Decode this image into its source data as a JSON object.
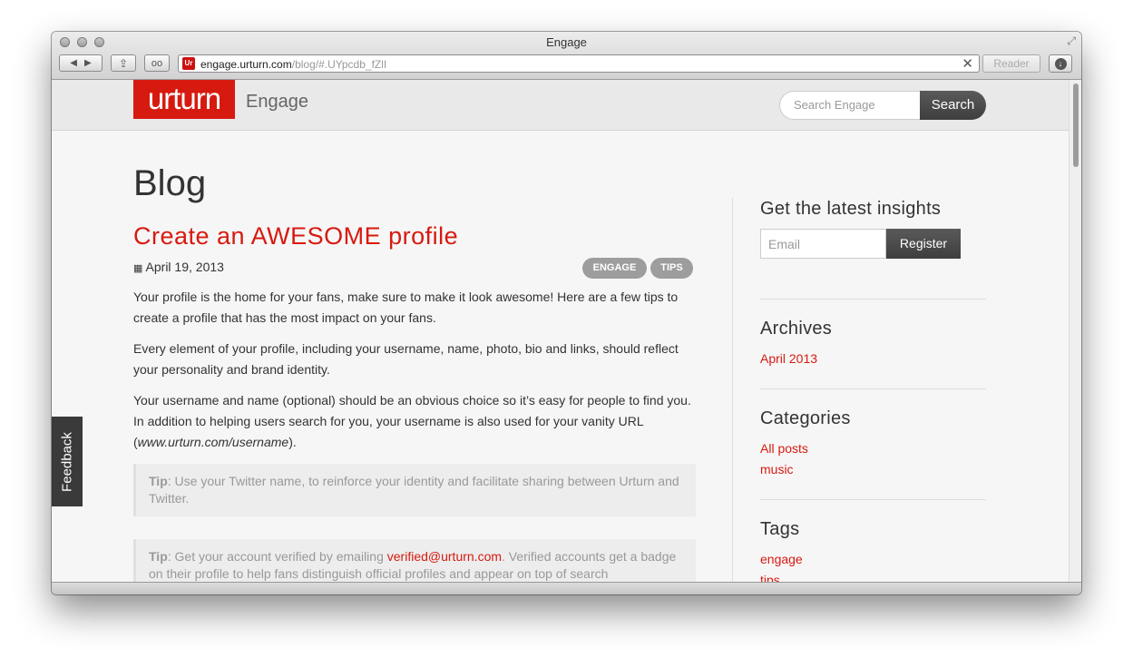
{
  "window": {
    "title": "Engage"
  },
  "toolbar": {
    "back_icon": "back-arrow-icon",
    "forward_icon": "forward-arrow-icon",
    "share_icon": "share-icon",
    "reading_list_icon": "glasses-icon",
    "url_host": "engage.urturn.com",
    "url_path": "/blog/#.UYpcdb_fZlI",
    "favicon_text": "Ur",
    "clear": "✕",
    "reader_label": "Reader"
  },
  "header": {
    "logo_text": "urturn",
    "brand": "Engage",
    "search_placeholder": "Search Engage",
    "search_label": "Search"
  },
  "feedback_label": "Feedback",
  "main": {
    "page_title": "Blog",
    "post": {
      "title": "Create an AWESOME profile",
      "date": "April 19, 2013",
      "tags": [
        "ENGAGE",
        "TIPS"
      ],
      "paragraphs": [
        "Your profile is the home for your fans, make sure to make it look awesome! Here are a few tips to create a profile that has the most impact on your fans.",
        "Every element of your profile, including your username, name, photo, bio and links, should reflect your personality and brand identity.",
        "Your username and name (optional) should be an obvious choice so it’s easy for people to find you. In addition to helping users search for you, your username is also used for your vanity URL ("
      ],
      "vanity_url": "www.urturn.com/username",
      "vanity_close": ").",
      "tips": [
        {
          "label": "Tip",
          "text": ": Use your Twitter name, to reinforce your identity and facilitate sharing between Urturn and Twitter."
        },
        {
          "label": "Tip",
          "text_before": ": Get your account verified by emailing ",
          "email": "verified@urturn.com",
          "text_after": ". Verified accounts get a badge on their profile to help fans distinguish official profiles and appear on top of search"
        }
      ]
    }
  },
  "sidebar": {
    "insights_heading": "Get the latest insights",
    "email_placeholder": "Email",
    "register_label": "Register",
    "archives_heading": "Archives",
    "archives": [
      "April 2013"
    ],
    "categories_heading": "Categories",
    "categories": [
      "All posts",
      "music"
    ],
    "tags_heading": "Tags",
    "tags": [
      "engage",
      "tips"
    ]
  },
  "colors": {
    "accent": "#d71a10",
    "dark_button": "#474747",
    "text": "#333333"
  }
}
